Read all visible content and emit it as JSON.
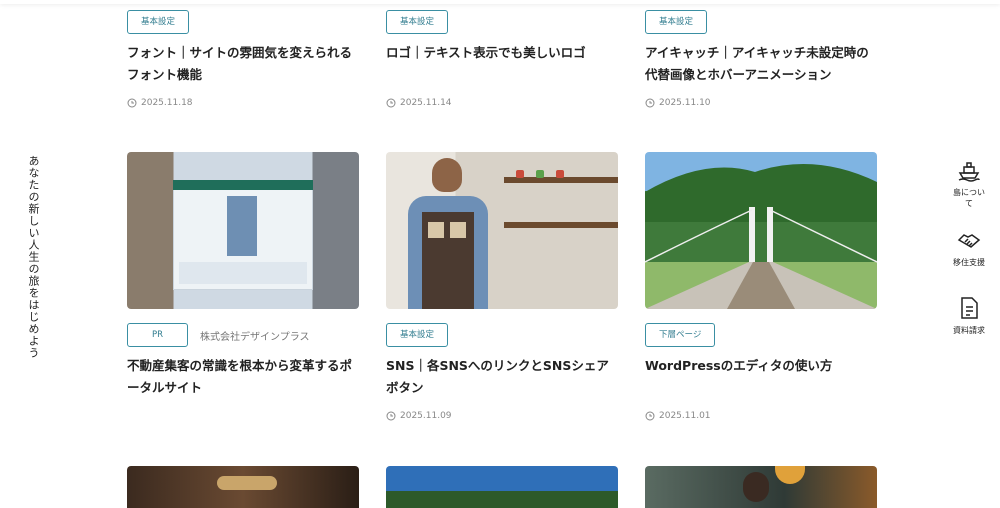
{
  "vertical_tagline": "あなたの新しい人生の旅をはじめよう",
  "side_nav": [
    {
      "label": "島について",
      "icon": "ship-icon"
    },
    {
      "label": "移住支援",
      "icon": "handshake-icon"
    },
    {
      "label": "資料請求",
      "icon": "document-icon"
    }
  ],
  "cards": [
    {
      "tag": "基本設定",
      "title": "フォント｜サイトの雰囲気を変えられるフォント機能",
      "date": "2025.11.18"
    },
    {
      "tag": "基本設定",
      "title": "ロゴ｜テキスト表示でも美しいロゴ",
      "date": "2025.11.14"
    },
    {
      "tag": "基本設定",
      "title": "アイキャッチ｜アイキャッチ未設定時の代替画像とホバーアニメーション",
      "date": "2025.11.10"
    },
    {
      "tag": "PR",
      "company": "株式会社デザインプラス",
      "title": "不動産集客の常識を根本から変革するポータルサイト",
      "date": ""
    },
    {
      "tag": "基本設定",
      "title": "SNS｜各SNSへのリンクとSNSシェアボタン",
      "date": "2025.11.09"
    },
    {
      "tag": "下層ページ",
      "title": "WordPressのエディタの使い方",
      "date": "2025.11.01"
    }
  ],
  "thumb_colors": {
    "accent": "#3a8fa3"
  }
}
